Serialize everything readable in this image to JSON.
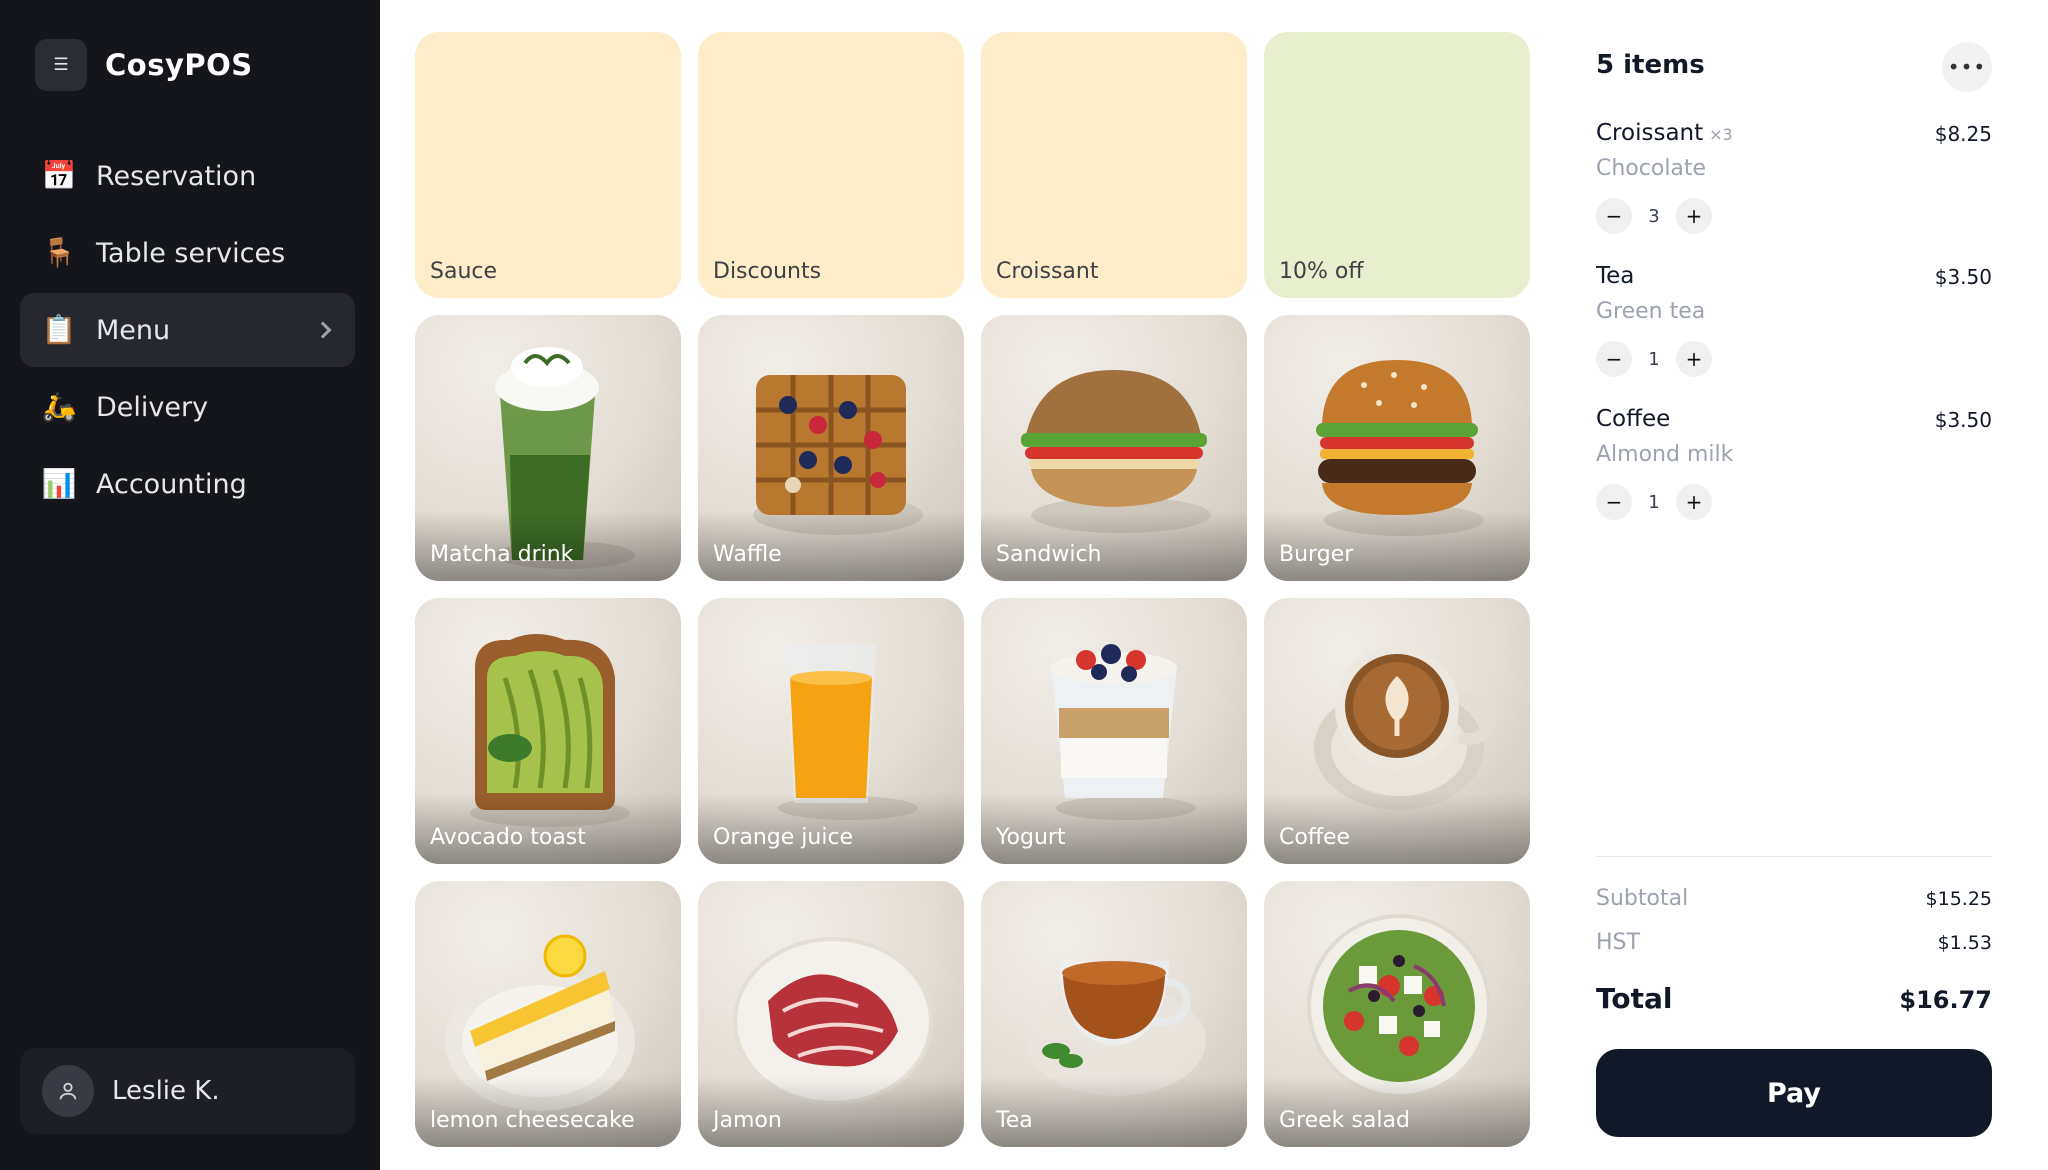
{
  "app": {
    "name": "CosyPOS"
  },
  "sidebar": {
    "items": [
      {
        "label": "Reservation",
        "icon": "calendar-icon"
      },
      {
        "label": "Table services",
        "icon": "chair-icon"
      },
      {
        "label": "Menu",
        "icon": "clipboard-icon",
        "active": true
      },
      {
        "label": "Delivery",
        "icon": "scooter-icon"
      },
      {
        "label": "Accounting",
        "icon": "bar-chart-icon"
      }
    ],
    "user": {
      "name": "Leslie K."
    }
  },
  "grid": {
    "categories": [
      {
        "label": "Sauce"
      },
      {
        "label": "Discounts"
      },
      {
        "label": "Croissant"
      },
      {
        "label": "10% off"
      }
    ],
    "products": [
      {
        "label": "Matcha drink",
        "icon": "matcha-drink-image"
      },
      {
        "label": "Waffle",
        "icon": "waffle-image"
      },
      {
        "label": "Sandwich",
        "icon": "sandwich-image"
      },
      {
        "label": "Burger",
        "icon": "burger-image"
      },
      {
        "label": "Avocado toast",
        "icon": "avocado-toast-image"
      },
      {
        "label": "Orange juice",
        "icon": "orange-juice-image"
      },
      {
        "label": "Yogurt",
        "icon": "yogurt-image"
      },
      {
        "label": "Coffee",
        "icon": "coffee-image"
      },
      {
        "label": "lemon cheesecake",
        "icon": "lemon-cheesecake-image"
      },
      {
        "label": "Jamon",
        "icon": "jamon-image"
      },
      {
        "label": "Tea",
        "icon": "tea-image"
      },
      {
        "label": "Greek salad",
        "icon": "greek-salad-image"
      }
    ]
  },
  "order": {
    "title": "5 items",
    "lines": [
      {
        "name": "Croissant",
        "qty_tag": "×3",
        "modifier": "Chocolate",
        "price": "$8.25",
        "qty": "3"
      },
      {
        "name": "Tea",
        "qty_tag": "",
        "modifier": "Green tea",
        "price": "$3.50",
        "qty": "1"
      },
      {
        "name": "Coffee",
        "qty_tag": "",
        "modifier": "Almond milk",
        "price": "$3.50",
        "qty": "1"
      }
    ],
    "subtotal_label": "Subtotal",
    "subtotal": "$15.25",
    "tax_label": "HST",
    "tax": "$1.53",
    "total_label": "Total",
    "total": "$16.77",
    "pay_label": "Pay"
  },
  "colors": {
    "sidebar_bg": "#15151c",
    "category_tile": "#ffecc8",
    "promo_tile": "#e8efcf",
    "pay_button": "#111827"
  }
}
